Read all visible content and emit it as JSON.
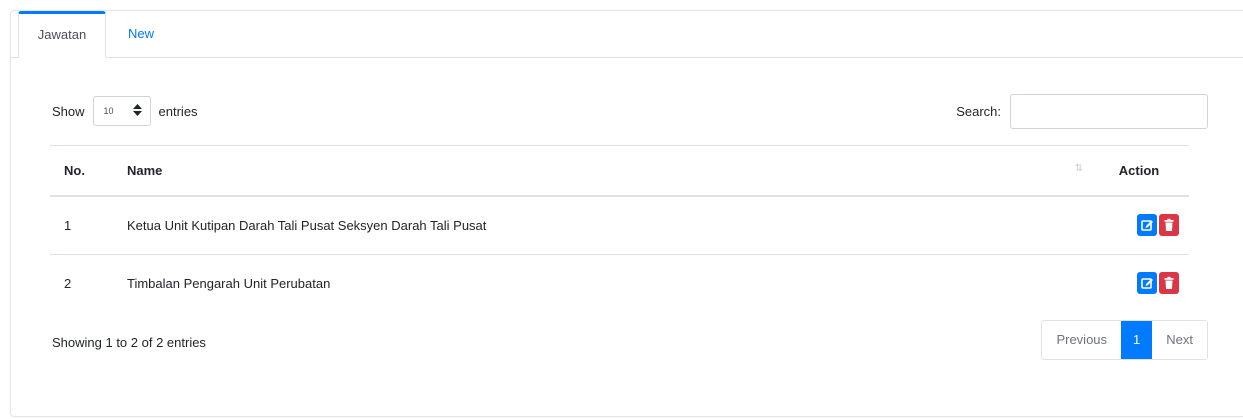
{
  "tabs": [
    {
      "label": "Jawatan",
      "active": true
    },
    {
      "label": "New",
      "active": false
    }
  ],
  "length_menu": {
    "show_label": "Show",
    "selected": "10",
    "entries_label": "entries"
  },
  "search": {
    "label": "Search:",
    "value": "",
    "placeholder": ""
  },
  "table": {
    "columns": [
      "No.",
      "Name",
      "Action"
    ],
    "rows": [
      {
        "no": "1",
        "name": "Ketua Unit Kutipan Darah Tali Pusat Seksyen Darah Tali Pusat"
      },
      {
        "no": "2",
        "name": "Timbalan Pengarah Unit Perubatan"
      }
    ]
  },
  "info": "Showing 1 to 2 of 2 entries",
  "pagination": {
    "previous": "Previous",
    "current": "1",
    "next": "Next"
  },
  "colors": {
    "primary": "#007bff",
    "danger": "#dc3545"
  }
}
